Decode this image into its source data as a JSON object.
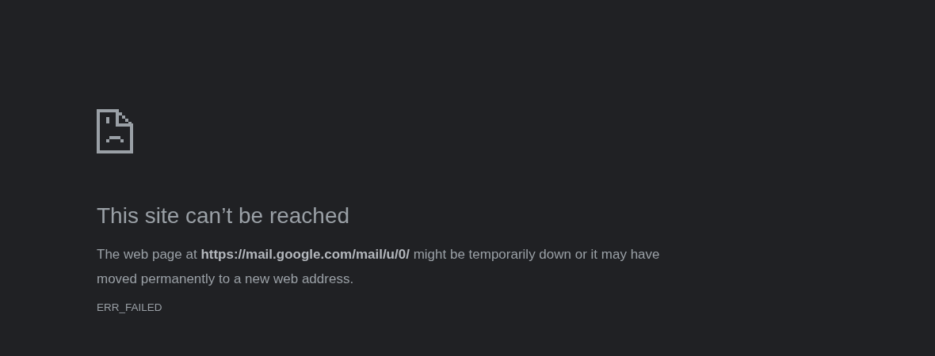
{
  "heading": "This site can’t be reached",
  "message": "The web page at **https://mail.google.com/mail/u/0/** might be temporarily down or it may have moved permanently to a new web address.",
  "error_code": "ERR_FAILED"
}
